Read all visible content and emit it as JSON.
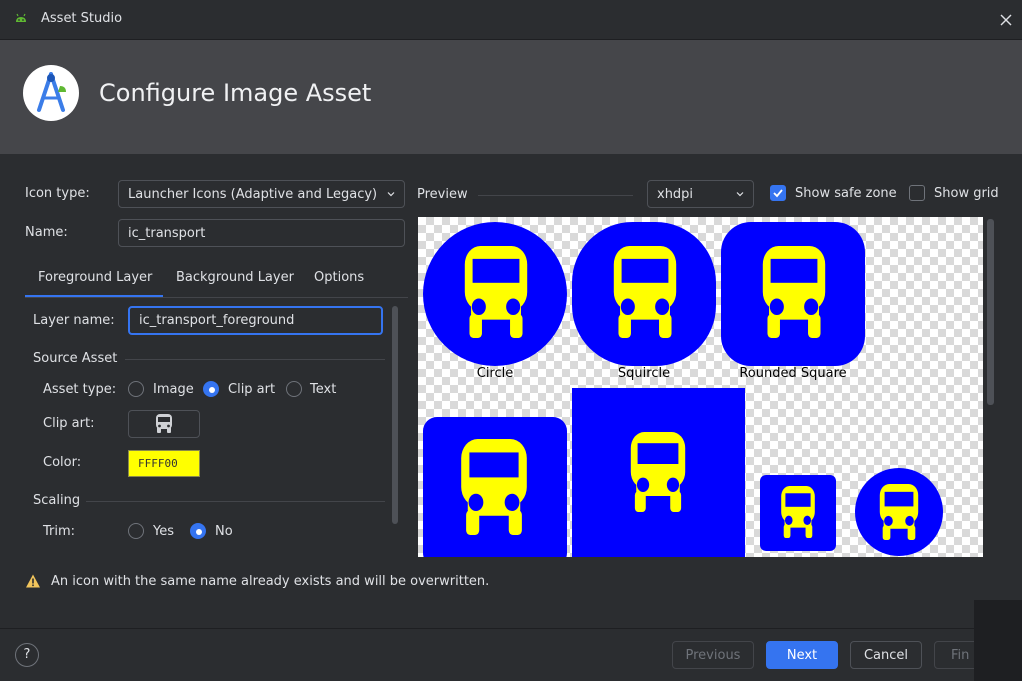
{
  "window": {
    "title": "Asset Studio",
    "close_icon": "close-icon",
    "app_icon": "android-icon"
  },
  "banner": {
    "title": "Configure Image Asset",
    "logo_icon": "android-studio-logo-icon"
  },
  "form": {
    "icon_type_label": "Icon type:",
    "icon_type_value": "Launcher Icons (Adaptive and Legacy)",
    "name_label": "Name:",
    "name_value": "ic_transport"
  },
  "tabs": [
    {
      "label": "Foreground Layer",
      "selected": true
    },
    {
      "label": "Background Layer",
      "selected": false
    },
    {
      "label": "Options",
      "selected": false
    }
  ],
  "layer": {
    "layer_name_label": "Layer name:",
    "layer_name_value": "ic_transport_foreground",
    "source_asset_heading": "Source Asset",
    "asset_type_label": "Asset type:",
    "asset_type_options": [
      "Image",
      "Clip art",
      "Text"
    ],
    "asset_type_selected": "Clip art",
    "clip_art_label": "Clip art:",
    "clip_art_icon": "bus-icon",
    "color_label": "Color:",
    "color_value": "FFFF00",
    "scaling_heading": "Scaling",
    "trim_label": "Trim:",
    "trim_options": [
      "Yes",
      "No"
    ],
    "trim_selected": "No"
  },
  "preview": {
    "label": "Preview",
    "density": "xhdpi",
    "show_safe_zone_label": "Show safe zone",
    "show_safe_zone": true,
    "show_grid_label": "Show grid",
    "show_grid": false,
    "shapes": [
      "Circle",
      "Squircle",
      "Rounded Square"
    ],
    "background_color": "#0000FF",
    "foreground_color": "#FFFF00"
  },
  "warning": {
    "text": "An icon with the same name already exists and will be overwritten.",
    "icon": "warning-icon"
  },
  "footer": {
    "help_label": "?",
    "previous_label": "Previous",
    "next_label": "Next",
    "cancel_label": "Cancel",
    "finish_label": "Fin"
  }
}
